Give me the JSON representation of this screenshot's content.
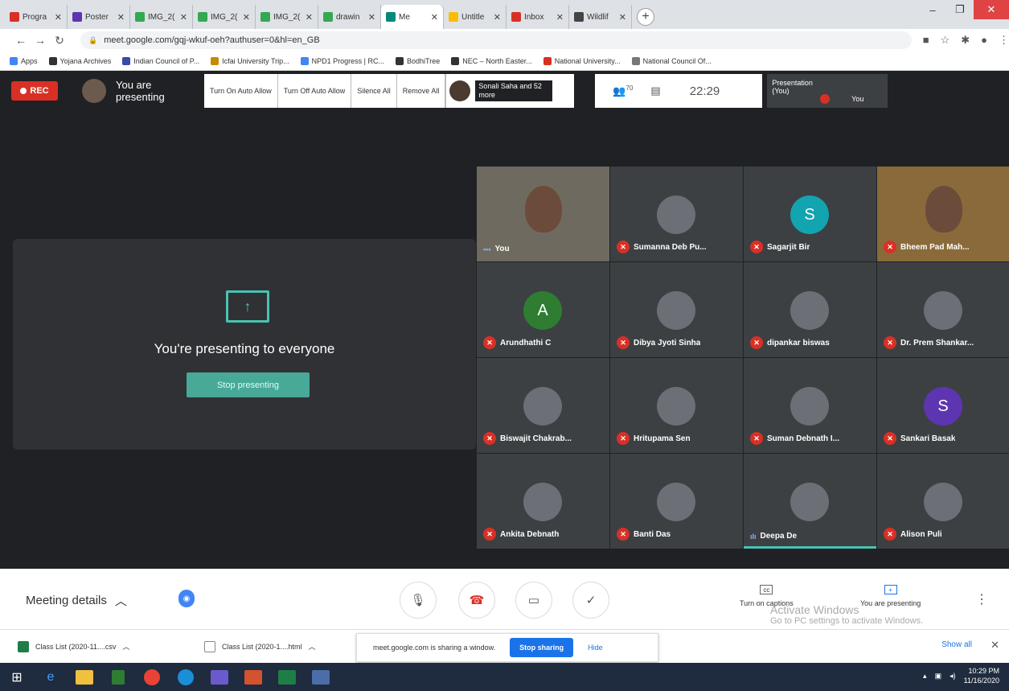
{
  "browser": {
    "tabs": [
      {
        "label": "Progra",
        "color": "#d93025",
        "active": false
      },
      {
        "label": "Poster",
        "color": "#5e35b1",
        "active": false
      },
      {
        "label": "IMG_2(",
        "color": "#34a853",
        "active": false
      },
      {
        "label": "IMG_2(",
        "color": "#34a853",
        "active": false
      },
      {
        "label": "IMG_2(",
        "color": "#34a853",
        "active": false
      },
      {
        "label": "drawin",
        "color": "#34a853",
        "active": false
      },
      {
        "label": "Me",
        "color": "#00897b",
        "active": true
      },
      {
        "label": "Untitle",
        "color": "#fbbc04",
        "active": false
      },
      {
        "label": "Inbox",
        "color": "#d93025",
        "active": false
      },
      {
        "label": "Wildlif",
        "color": "#444444",
        "active": false
      }
    ],
    "url": "meet.google.com/gqj-wkuf-oeh?authuser=0&hl=en_GB",
    "bookmarks": [
      {
        "label": "Apps",
        "color": "#4285f4"
      },
      {
        "label": "Yojana Archives",
        "color": "#333333"
      },
      {
        "label": "Indian Council of P...",
        "color": "#3949ab"
      },
      {
        "label": "Icfai University Trip...",
        "color": "#c58a00"
      },
      {
        "label": "NPD1 Progress | RC...",
        "color": "#4285f4"
      },
      {
        "label": "BodhiTree",
        "color": "#333333"
      },
      {
        "label": "NEC – North Easter...",
        "color": "#333333"
      },
      {
        "label": "National University...",
        "color": "#d93025"
      },
      {
        "label": "National Council Of...",
        "color": "#777777"
      }
    ]
  },
  "meet": {
    "rec_label": "REC",
    "presenting_status": "You are presenting",
    "ext_buttons": [
      "Turn On Auto Allow",
      "Turn Off Auto Allow",
      "Silence All",
      "Remove All"
    ],
    "people_summary": "Sonali Saha and 52 more",
    "participant_count": "70",
    "clock": "22:29",
    "self_tile_label": "Presentation (You)",
    "self_tile_name": "You",
    "present_panel": {
      "title": "You're presenting to everyone",
      "stop_label": "Stop presenting"
    },
    "participants": [
      {
        "name": "You",
        "kind": "video",
        "muted": false
      },
      {
        "name": "Sumanna Deb Pu...",
        "kind": "photo",
        "muted": true
      },
      {
        "name": "Sagarjit Bir",
        "kind": "letter",
        "letter": "S",
        "color": "#12a4af",
        "muted": true
      },
      {
        "name": "Bheem Pad Mah...",
        "kind": "video2",
        "muted": true
      },
      {
        "name": "Arundhathi C",
        "kind": "letter",
        "letter": "A",
        "color": "#2e7d32",
        "muted": true
      },
      {
        "name": "Dibya Jyoti Sinha",
        "kind": "photo",
        "muted": true
      },
      {
        "name": "dipankar biswas",
        "kind": "photo",
        "muted": true
      },
      {
        "name": "Dr. Prem Shankar...",
        "kind": "photo",
        "muted": true
      },
      {
        "name": "Biswajit Chakrab...",
        "kind": "photo",
        "muted": true
      },
      {
        "name": "Hritupama Sen",
        "kind": "photo",
        "muted": true
      },
      {
        "name": "Suman Debnath I...",
        "kind": "photo",
        "muted": true
      },
      {
        "name": "Sankari Basak",
        "kind": "letter",
        "letter": "S",
        "color": "#5e35b1",
        "muted": true
      },
      {
        "name": "Ankita Debnath",
        "kind": "photo",
        "muted": true
      },
      {
        "name": "Banti Das",
        "kind": "photo",
        "muted": true
      },
      {
        "name": "Deepa De",
        "kind": "photo",
        "muted": false,
        "speaking": true
      },
      {
        "name": "Alison Puli",
        "kind": "photo",
        "muted": true
      }
    ],
    "bottom": {
      "meeting_details": "Meeting details",
      "captions_label": "Turn on captions",
      "presenting_label": "You are presenting",
      "watermark_line1": "Activate Windows",
      "watermark_line2": "Go to PC settings to activate Windows."
    }
  },
  "downloads": {
    "items": [
      {
        "label": "Class List (2020-11....csv",
        "type": "csv"
      },
      {
        "label": "Class List (2020-1....html",
        "type": "html"
      }
    ],
    "share_text": "meet.google.com is sharing a window.",
    "stop_sharing": "Stop sharing",
    "hide": "Hide",
    "show_all": "Show all"
  },
  "taskbar": {
    "time": "10:29 PM",
    "date": "11/16/2020"
  }
}
